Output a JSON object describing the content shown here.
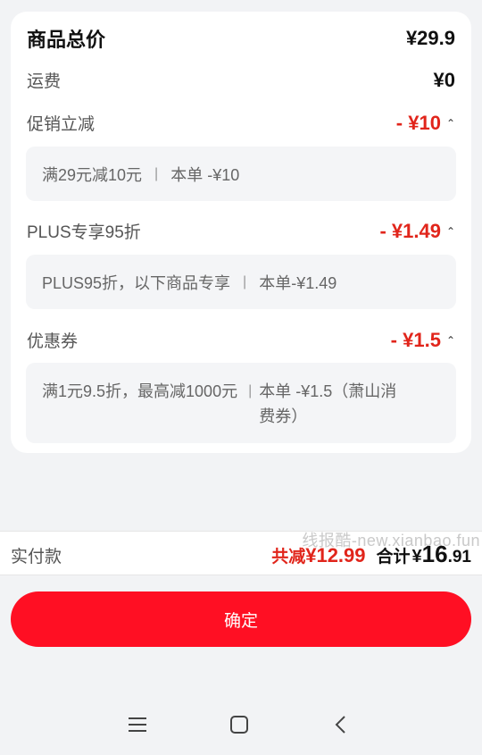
{
  "summary": {
    "total_label": "商品总价",
    "total_value": "¥29.9",
    "shipping_label": "运费",
    "shipping_value": "¥0"
  },
  "discounts": [
    {
      "label": "促销立减",
      "value": "- ¥10",
      "detail_left": "满29元减10元",
      "detail_right": "本单 -¥10"
    },
    {
      "label": "PLUS专享95折",
      "value": "- ¥1.49",
      "detail_left": "PLUS95折，以下商品专享",
      "detail_right": "本单-¥1.49"
    },
    {
      "label": "优惠券",
      "value": "- ¥1.5",
      "detail_left": "满1元9.5折，最高减1000元",
      "detail_right": "本单 -¥1.5（萧山消费券）"
    }
  ],
  "payment": {
    "label": "实付款",
    "saved_label": "共减",
    "saved_value": "¥12.99",
    "sum_label": "合计",
    "sum_currency": "¥",
    "sum_int": "16",
    "sum_dec": ".91"
  },
  "watermark": "线报酷-new.xianbao.fun",
  "confirm_label": "确定",
  "colors": {
    "accent_red": "#e1251b",
    "button_red": "#ff0f23",
    "background": "#f2f3f5"
  },
  "icons": {
    "caret": "chevron-up-icon",
    "nav_menu": "menu-icon",
    "nav_home": "home-icon",
    "nav_back": "back-icon"
  }
}
